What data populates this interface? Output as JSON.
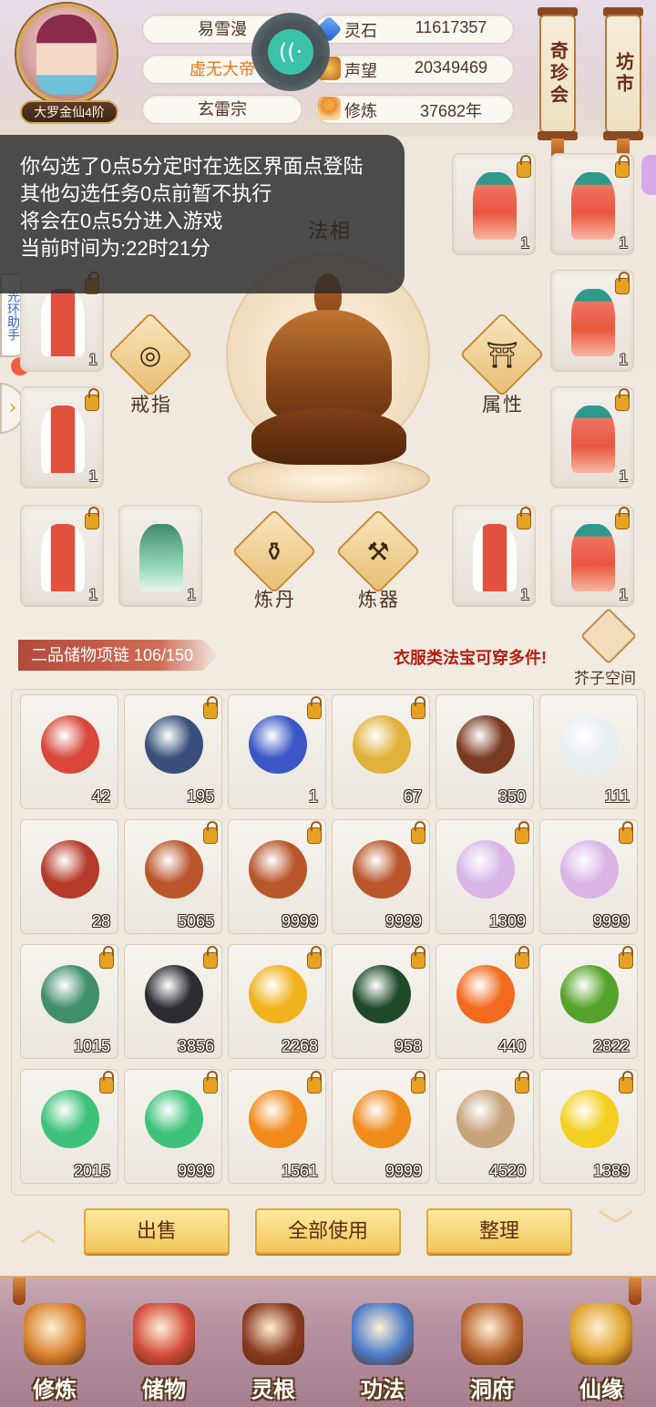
{
  "player": {
    "rank": "大罗金仙4阶",
    "name": "易雪漫",
    "title": "虚无大帝",
    "sect": "玄雷宗"
  },
  "stats": [
    {
      "label": "灵石",
      "value": "11617357",
      "icon": "spirit-stone-icon"
    },
    {
      "label": "声望",
      "value": "20349469",
      "icon": "fame-icon"
    },
    {
      "label": "修炼",
      "value": "37682年",
      "icon": "cultivation-icon"
    }
  ],
  "scrolls": [
    {
      "label": "奇珍会"
    },
    {
      "label": "坊市"
    }
  ],
  "notice": {
    "lines": [
      "你勾选了0点5分定时在选区界面点登陆",
      "其他勾选任务0点前暂不执行",
      "将会在0点5分进入游戏",
      "当前时间为:22时21分"
    ]
  },
  "side": {
    "helper_label": "光环助手"
  },
  "equipment": {
    "center_labels": {
      "dharma": "法相",
      "ring": "戒指",
      "attribute": "属性",
      "alchemy": "炼丹",
      "forge": "炼器"
    },
    "slots": [
      {
        "count": "1",
        "kind": "red-robe"
      },
      {
        "count": "1",
        "kind": "red-robe"
      },
      {
        "count": "1",
        "kind": "white-red-robe"
      },
      {
        "count": "1",
        "kind": "red-robe"
      },
      {
        "count": "1",
        "kind": "white-red-robe"
      },
      {
        "count": "1",
        "kind": "red-robe"
      },
      {
        "count": "1",
        "kind": "white-red-robe"
      },
      {
        "count": "1",
        "kind": "green-robe"
      },
      {
        "count": "1",
        "kind": "white-red-robe"
      },
      {
        "count": "1",
        "kind": "red-robe"
      }
    ]
  },
  "bag": {
    "title": "二品储物项链 106/150",
    "tip": "衣服类法宝可穿多件!",
    "mustard_space": "芥子空间",
    "items": [
      {
        "count": "42",
        "icon": "peach-icon",
        "color": "#d9463a"
      },
      {
        "count": "195",
        "icon": "taiji-compass-icon",
        "color": "#3a4f7a"
      },
      {
        "count": "1",
        "icon": "blue-flower-icon",
        "color": "#3a56c7"
      },
      {
        "count": "67",
        "icon": "golden-herb-icon",
        "color": "#e0b23a"
      },
      {
        "count": "350",
        "icon": "wood-log-icon",
        "color": "#7a3a22"
      },
      {
        "count": "111",
        "icon": "crystal-icon",
        "color": "#e7eef2"
      },
      {
        "count": "28",
        "icon": "talisman-icon",
        "color": "#b43a2a"
      },
      {
        "count": "5065",
        "icon": "scorpion-icon",
        "color": "#b8552a"
      },
      {
        "count": "9999",
        "icon": "scorpion-icon",
        "color": "#b8552a"
      },
      {
        "count": "9999",
        "icon": "scorpion-icon",
        "color": "#b8552a"
      },
      {
        "count": "1309",
        "icon": "lily-icon",
        "color": "#d8b5e6"
      },
      {
        "count": "9999",
        "icon": "lily-icon",
        "color": "#d8b5e6"
      },
      {
        "count": "1015",
        "icon": "peacock-feather-icon",
        "color": "#3f8f6a"
      },
      {
        "count": "3856",
        "icon": "dark-ore-icon",
        "color": "#2c2d33"
      },
      {
        "count": "2268",
        "icon": "amber-crystal-icon",
        "color": "#f1b21e"
      },
      {
        "count": "958",
        "icon": "green-ore-icon",
        "color": "#1f4a2a"
      },
      {
        "count": "440",
        "icon": "fire-crystal-icon",
        "color": "#f26a1f"
      },
      {
        "count": "2822",
        "icon": "bamboo-icon",
        "color": "#55a22a"
      },
      {
        "count": "2015",
        "icon": "green-swirl-icon",
        "color": "#3ec27a"
      },
      {
        "count": "9999",
        "icon": "green-swirl-icon",
        "color": "#3ec27a"
      },
      {
        "count": "1561",
        "icon": "fire-orb-icon",
        "color": "#f08a1a"
      },
      {
        "count": "9999",
        "icon": "fire-orb-icon",
        "color": "#f08a1a"
      },
      {
        "count": "4520",
        "icon": "scroll-bowl-icon",
        "color": "#c7a37a"
      },
      {
        "count": "1389",
        "icon": "yellow-gem-icon",
        "color": "#f4d020"
      }
    ]
  },
  "actions": {
    "sell": "出售",
    "use_all": "全部使用",
    "sort": "整理"
  },
  "nav": [
    {
      "label": "修炼",
      "icon": "cultivate-icon",
      "color": "#d9822e"
    },
    {
      "label": "储物",
      "icon": "storage-bag-icon",
      "color": "#d24a3a"
    },
    {
      "label": "灵根",
      "icon": "spirit-root-icon",
      "color": "#8a3a1f"
    },
    {
      "label": "功法",
      "icon": "technique-book-icon",
      "color": "#4a7ac9"
    },
    {
      "label": "洞府",
      "icon": "cave-house-icon",
      "color": "#b8622a"
    },
    {
      "label": "仙缘",
      "icon": "gourd-icon",
      "color": "#e0a22a"
    }
  ]
}
